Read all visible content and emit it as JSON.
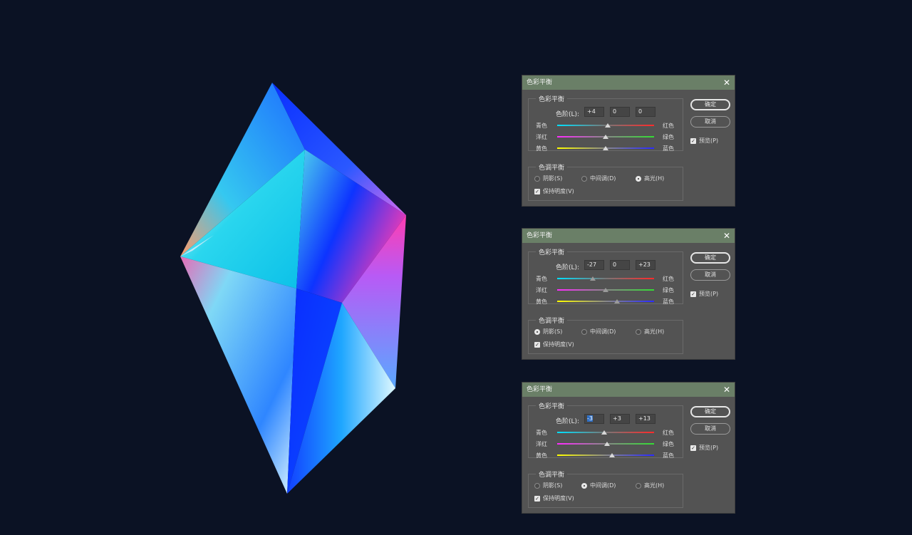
{
  "dialogs": [
    {
      "title": "色彩平衡",
      "color_balance": {
        "legend": "色彩平衡",
        "levels_label": "色阶(L):",
        "levels": [
          "+4",
          "0",
          "0"
        ],
        "sliders": [
          {
            "left": "青色",
            "right": "红色",
            "value": 4
          },
          {
            "left": "洋红",
            "right": "绿色",
            "value": 0
          },
          {
            "left": "黄色",
            "right": "蓝色",
            "value": 0
          }
        ]
      },
      "tone_balance": {
        "legend": "色调平衡",
        "options": [
          "阴影(S)",
          "中间调(D)",
          "高光(H)"
        ],
        "selected": "高光(H)",
        "preserve_label": "保持明度(V)",
        "preserve_checked": true
      },
      "buttons": {
        "ok": "确定",
        "cancel": "取消"
      },
      "preview_label": "预览(P)",
      "preview_checked": true
    },
    {
      "title": "色彩平衡",
      "color_balance": {
        "legend": "色彩平衡",
        "levels_label": "色阶(L):",
        "levels": [
          "-27",
          "0",
          "+23"
        ],
        "sliders": [
          {
            "left": "青色",
            "right": "红色",
            "value": -27
          },
          {
            "left": "洋红",
            "right": "绿色",
            "value": 0
          },
          {
            "left": "黄色",
            "right": "蓝色",
            "value": 23
          }
        ]
      },
      "tone_balance": {
        "legend": "色调平衡",
        "options": [
          "阴影(S)",
          "中间调(D)",
          "高光(H)"
        ],
        "selected": "阴影(S)",
        "preserve_label": "保持明度(V)",
        "preserve_checked": true
      },
      "buttons": {
        "ok": "确定",
        "cancel": "取消"
      },
      "preview_label": "预览(P)",
      "preview_checked": true
    },
    {
      "title": "色彩平衡",
      "color_balance": {
        "legend": "色彩平衡",
        "levels_label": "色阶(L):",
        "levels": [
          "-3",
          "+3",
          "+13"
        ],
        "sliders": [
          {
            "left": "青色",
            "right": "红色",
            "value": -3
          },
          {
            "left": "洋红",
            "right": "绿色",
            "value": 3
          },
          {
            "left": "黄色",
            "right": "蓝色",
            "value": 13
          }
        ]
      },
      "tone_balance": {
        "legend": "色调平衡",
        "options": [
          "阴影(S)",
          "中间调(D)",
          "高光(H)"
        ],
        "selected": "中间调(D)",
        "preserve_label": "保持明度(V)",
        "preserve_checked": true
      },
      "buttons": {
        "ok": "确定",
        "cancel": "取消"
      },
      "preview_label": "预览(P)",
      "preview_checked": true
    }
  ],
  "colors": {
    "background": "#0b1224",
    "titlebar": "#6a7f67",
    "panel": "#535353"
  }
}
